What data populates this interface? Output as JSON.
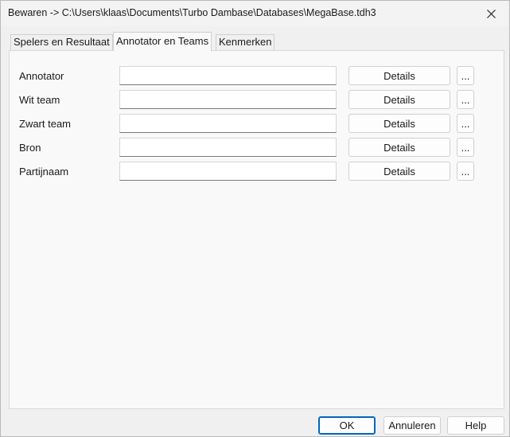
{
  "window": {
    "title": "Bewaren -> C:\\Users\\klaas\\Documents\\Turbo Dambase\\Databases\\MegaBase.tdh3",
    "close_icon": "close-icon"
  },
  "tabs": [
    {
      "label": "Spelers en Resultaat",
      "active": false
    },
    {
      "label": "Annotator en Teams",
      "active": true
    },
    {
      "label": "Kenmerken",
      "active": false
    }
  ],
  "rows": [
    {
      "label": "Annotator",
      "value": "",
      "details_label": "Details",
      "more_label": "..."
    },
    {
      "label": "Wit team",
      "value": "",
      "details_label": "Details",
      "more_label": "..."
    },
    {
      "label": "Zwart team",
      "value": "",
      "details_label": "Details",
      "more_label": "..."
    },
    {
      "label": "Bron",
      "value": "",
      "details_label": "Details",
      "more_label": "..."
    },
    {
      "label": "Partijnaam",
      "value": "",
      "details_label": "Details",
      "more_label": "..."
    }
  ],
  "footer": {
    "ok_label": "OK",
    "cancel_label": "Annuleren",
    "help_label": "Help"
  },
  "colors": {
    "accent": "#0067c0",
    "panel_background": "#f9f9f9",
    "window_background": "#f0f0f0"
  }
}
